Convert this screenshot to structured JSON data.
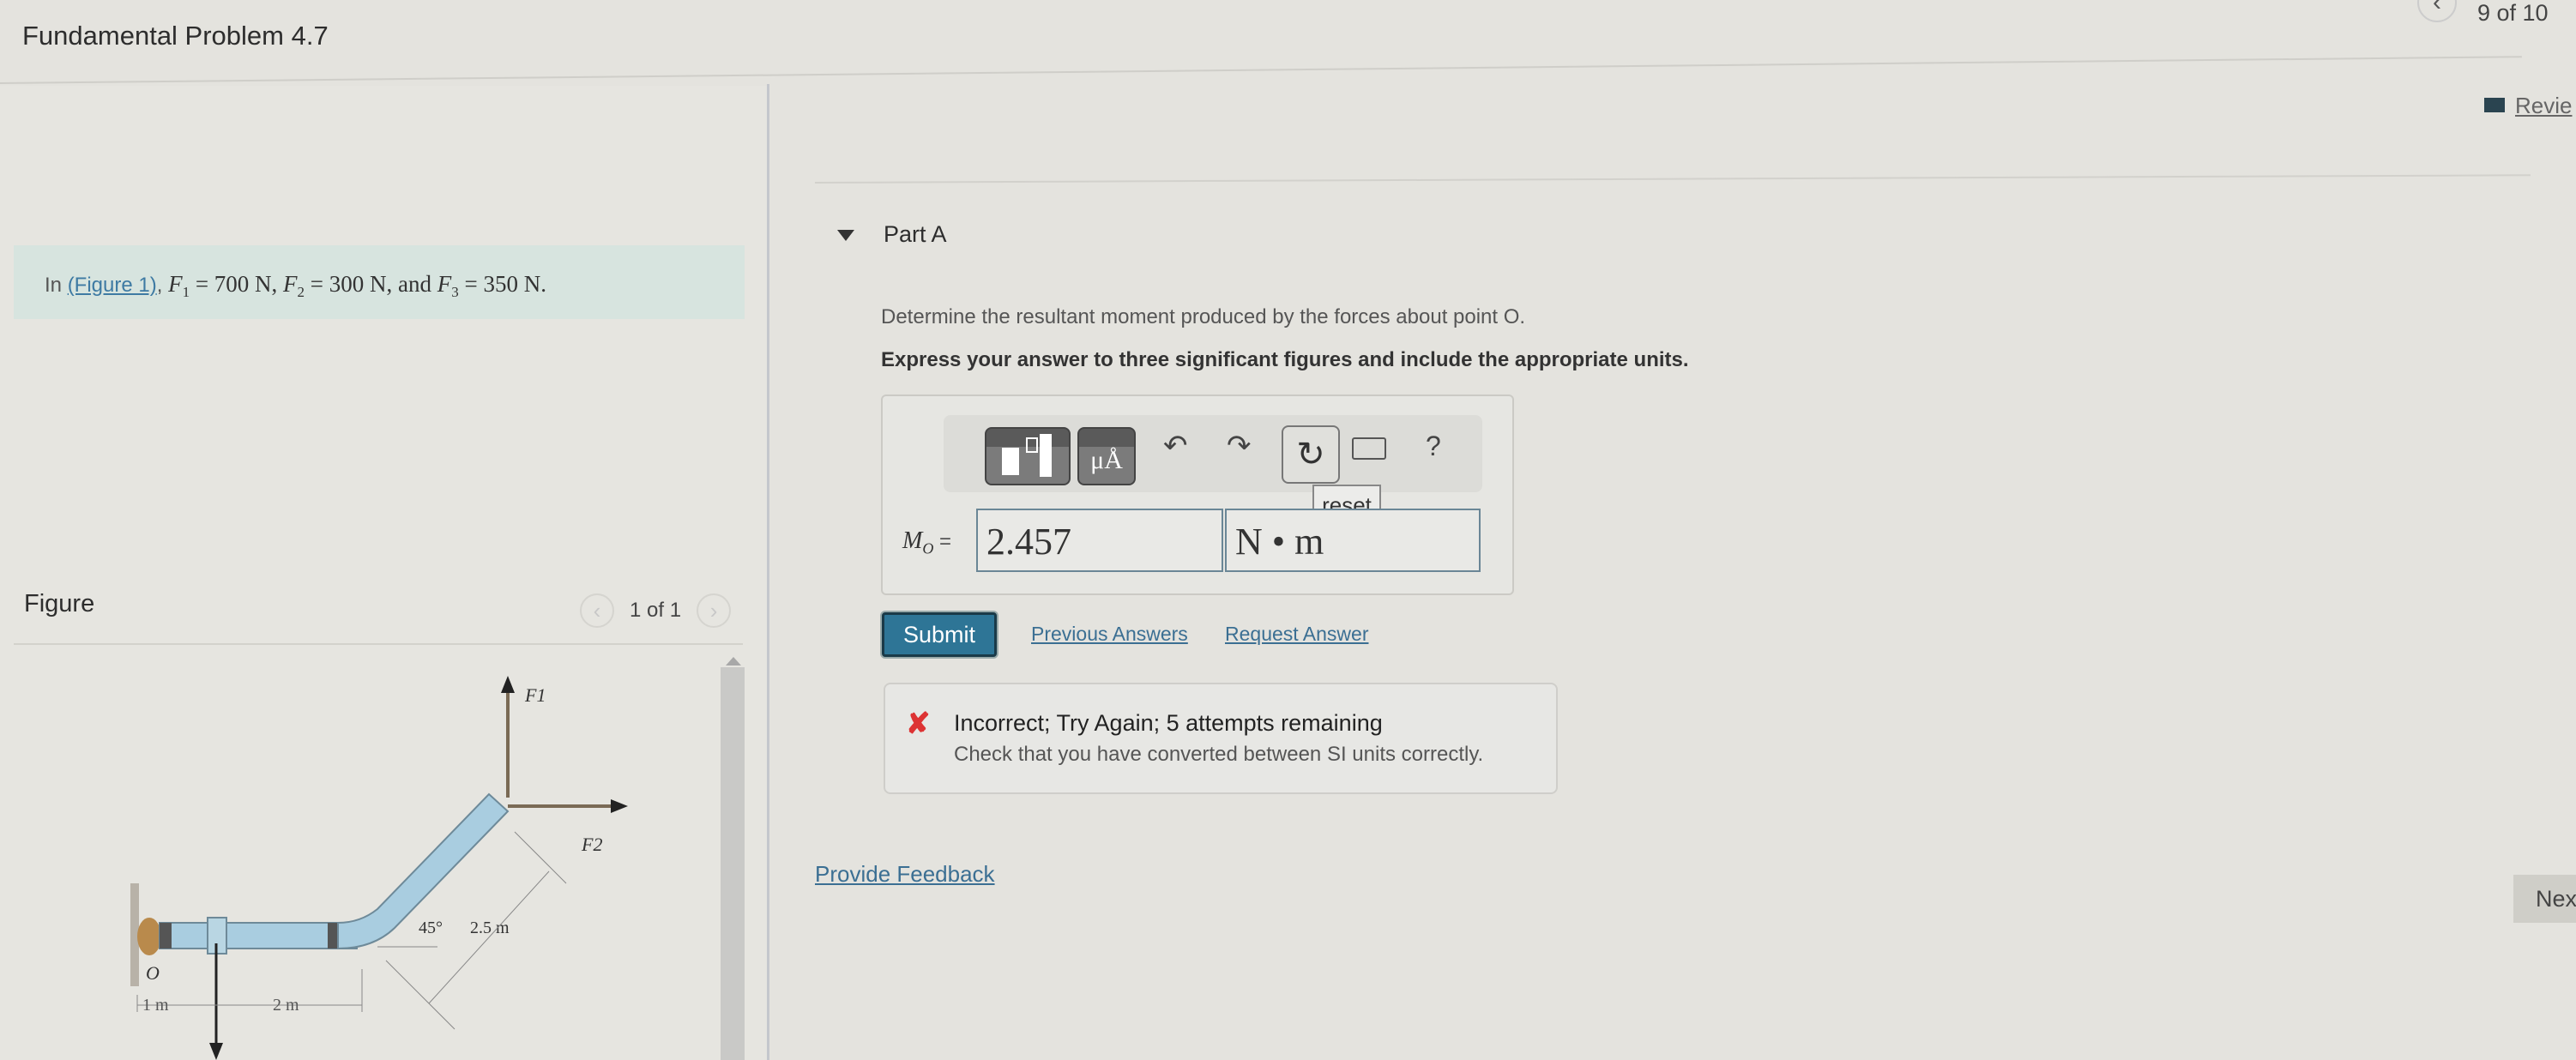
{
  "header": {
    "title": "Fundamental Problem 4.7",
    "nav_prev_icon": "chevron-left-icon",
    "nav_count": "9 of 10",
    "review_label": "Revie",
    "next_label": "Nex"
  },
  "problem": {
    "prefix": "In ",
    "figure_link": "(Figure 1)",
    "f1_sym": "F",
    "f1_sub": "1",
    "f1_val": " = 700 N, ",
    "f2_sym": "F",
    "f2_sub": "2",
    "f2_val": " = 300 N, and ",
    "f3_sym": "F",
    "f3_sub": "3",
    "f3_val": " = 350 N."
  },
  "figure": {
    "label": "Figure",
    "pager": "1 of 1",
    "labels": {
      "f1": "F1",
      "f2": "F2",
      "origin": "O",
      "angle": "45°",
      "diag_len": "2.5 m",
      "dim1": "1 m",
      "dim2": "2 m"
    }
  },
  "partA": {
    "title": "Part A",
    "question": "Determine the resultant moment produced by the forces about point O.",
    "instruction": "Express your answer to three significant figures and include the appropriate units.",
    "toolbar": {
      "templates_icon": "templates-icon",
      "units_label": "μÅ",
      "undo_icon": "undo-icon",
      "redo_icon": "redo-icon",
      "reset_icon": "reset-icon",
      "keyboard_icon": "keyboard-icon",
      "help_label": "?",
      "tooltip": "reset"
    },
    "answer_label": "MO =",
    "answer_value": "2.457",
    "answer_units": "N • m",
    "submit_label": "Submit",
    "previous_answers": "Previous Answers",
    "request_answer": "Request Answer",
    "feedback": {
      "status": "Incorrect; Try Again; 5 attempts remaining",
      "hint": "Check that you have converted between SI units correctly."
    }
  },
  "provide_feedback": "Provide Feedback"
}
